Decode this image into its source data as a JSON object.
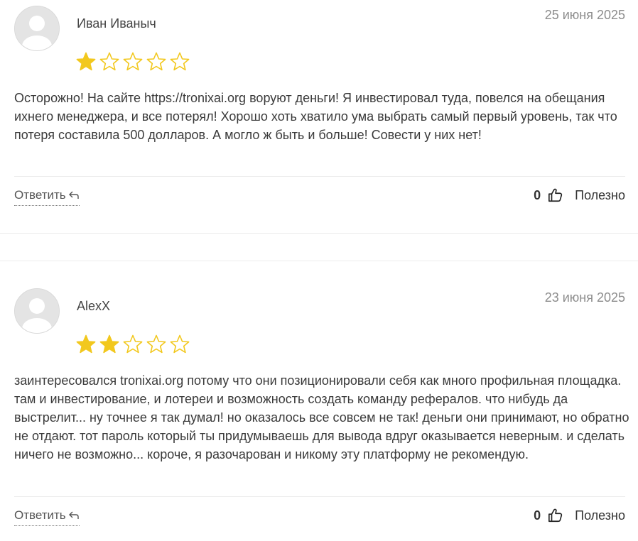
{
  "reviews": [
    {
      "author": "Иван Иваныч",
      "date": "25 июня 2025",
      "rating": 1,
      "max_rating": 5,
      "text": "Осторожно! На сайте https://tronixai.org воруют деньги! Я инвестировал туда, повелся на обещания ихнего менеджера, и все потерял! Хорошо хоть хватило ума выбрать самый первый уровень, так что потеря составила 500 долларов. А могло ж быть и больше! Совести у них нет!",
      "reply_label": "Ответить",
      "helpful_count": "0",
      "helpful_label": "Полезно"
    },
    {
      "author": "AlexX",
      "date": "23 июня 2025",
      "rating": 2,
      "max_rating": 5,
      "text": "заинтересовался tronixai.org потому что они позиционировали себя как много профильная площадка. там и инвестирование, и лотереи и возможность создать команду рефералов. что нибудь да выстрелит... ну точнее я так думал! но оказалось все совсем не так! деньги они принимают, но обратно не отдают. тот пароль который ты придумываешь для вывода вдруг оказывается неверным. и сделать ничего не возможно... короче, я разочарован и никому эту платформу не рекомендую.",
      "reply_label": "Ответить",
      "helpful_count": "0",
      "helpful_label": "Полезно"
    }
  ],
  "colors": {
    "star_filled": "#f2c81e",
    "star_empty": "#f2c81e",
    "date": "#8c8c8c",
    "divider": "#ececec"
  },
  "icons": {
    "avatar": "default-user-avatar",
    "reply": "reply-arrow-icon",
    "helpful": "thumbs-up-icon",
    "star": "star-icon"
  }
}
